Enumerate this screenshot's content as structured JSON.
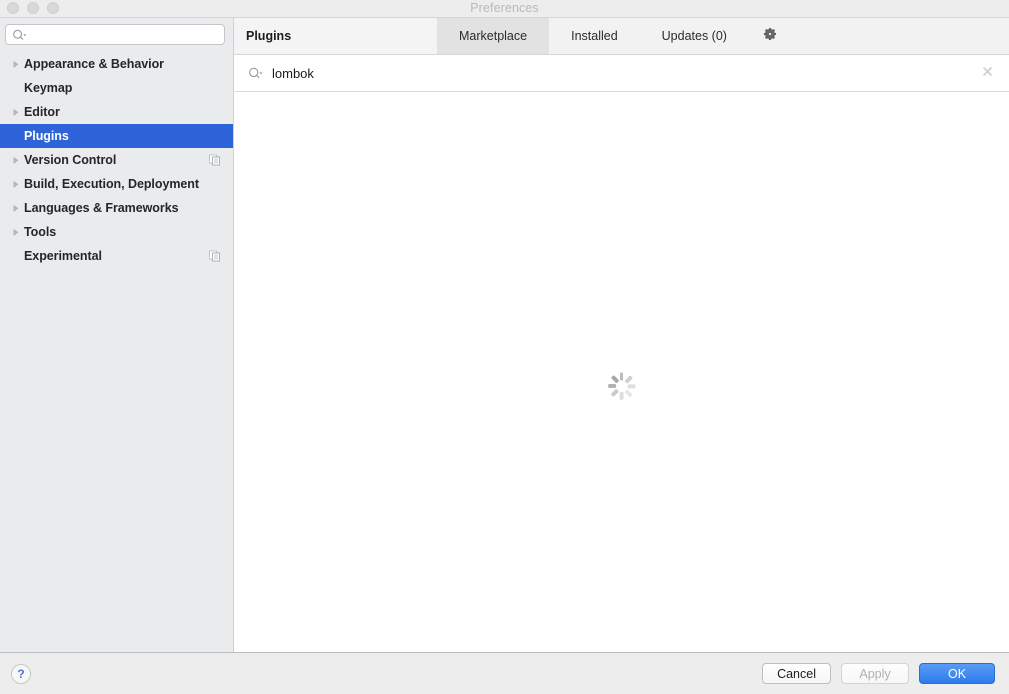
{
  "window": {
    "title": "Preferences",
    "traffic_lights": [
      "close",
      "minimize",
      "zoom"
    ]
  },
  "sidebar": {
    "search": {
      "value": "",
      "placeholder": "",
      "icon": "search-icon"
    },
    "items": [
      {
        "label": "Appearance & Behavior",
        "expandable": true,
        "selected": false,
        "project_icon": false
      },
      {
        "label": "Keymap",
        "expandable": false,
        "selected": false,
        "project_icon": false
      },
      {
        "label": "Editor",
        "expandable": true,
        "selected": false,
        "project_icon": false
      },
      {
        "label": "Plugins",
        "expandable": false,
        "selected": true,
        "project_icon": false
      },
      {
        "label": "Version Control",
        "expandable": true,
        "selected": false,
        "project_icon": true
      },
      {
        "label": "Build, Execution, Deployment",
        "expandable": true,
        "selected": false,
        "project_icon": false
      },
      {
        "label": "Languages & Frameworks",
        "expandable": true,
        "selected": false,
        "project_icon": false
      },
      {
        "label": "Tools",
        "expandable": true,
        "selected": false,
        "project_icon": false
      },
      {
        "label": "Experimental",
        "expandable": false,
        "selected": false,
        "project_icon": true
      }
    ]
  },
  "content": {
    "panel_title": "Plugins",
    "tabs": [
      {
        "label": "Marketplace",
        "active": true
      },
      {
        "label": "Installed",
        "active": false
      },
      {
        "label": "Updates (0)",
        "active": false
      }
    ],
    "gear_icon": "gear-icon",
    "search": {
      "value": "lombok",
      "placeholder": "",
      "icon": "search-icon",
      "clear_icon": "close-icon"
    },
    "loading": {
      "visible": true,
      "label": ""
    }
  },
  "footer": {
    "help_label": "?",
    "cancel_label": "Cancel",
    "apply_label": "Apply",
    "ok_label": "OK"
  },
  "colors": {
    "selection_blue": "#2f63d8",
    "primary_button": "#2c7ced",
    "sidebar_bg": "#e9ebed",
    "footer_bg": "#ededed",
    "tab_active_bg": "#e2e2e2",
    "help_blue": "#4a77cf"
  }
}
